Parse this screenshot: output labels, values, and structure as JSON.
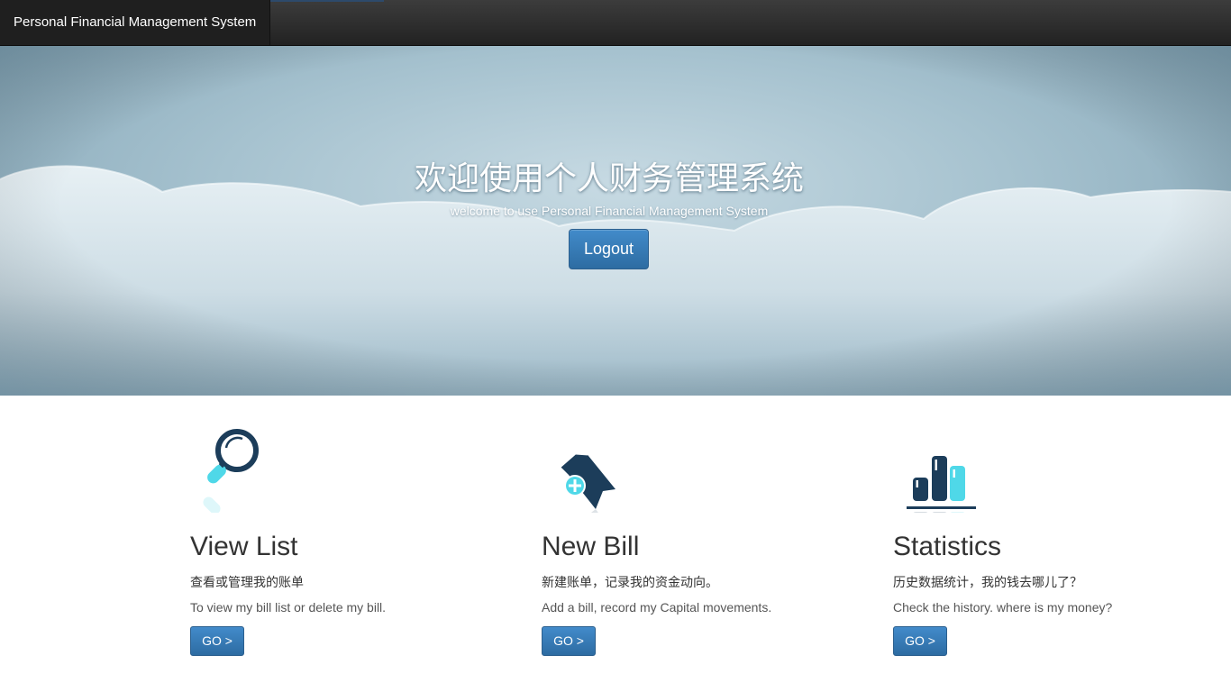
{
  "navbar": {
    "brand": "Personal Financial Management System"
  },
  "hero": {
    "title": "欢迎使用个人财务管理系统",
    "subtitle": "welcome to use Personal Financial Management System",
    "logout_label": "Logout"
  },
  "features": [
    {
      "icon": "magnifier-icon",
      "title": "View List",
      "cn": "查看或管理我的账单",
      "desc": "To view my bill list or delete my bill.",
      "go_label": "GO >"
    },
    {
      "icon": "add-bookmark-icon",
      "title": "New Bill",
      "cn": "新建账单，记录我的资金动向。",
      "desc": "Add a bill, record my Capital movements.",
      "go_label": "GO >"
    },
    {
      "icon": "bar-chart-icon",
      "title": "Statistics",
      "cn": "历史数据统计，我的钱去哪儿了？",
      "desc": "Check the history. where is my money?",
      "go_label": "GO >"
    }
  ],
  "colors": {
    "navbar": "#2a2a2a",
    "button": "#337ab7",
    "icon_dark": "#1c3d5a",
    "icon_accent": "#4fd8e8"
  }
}
